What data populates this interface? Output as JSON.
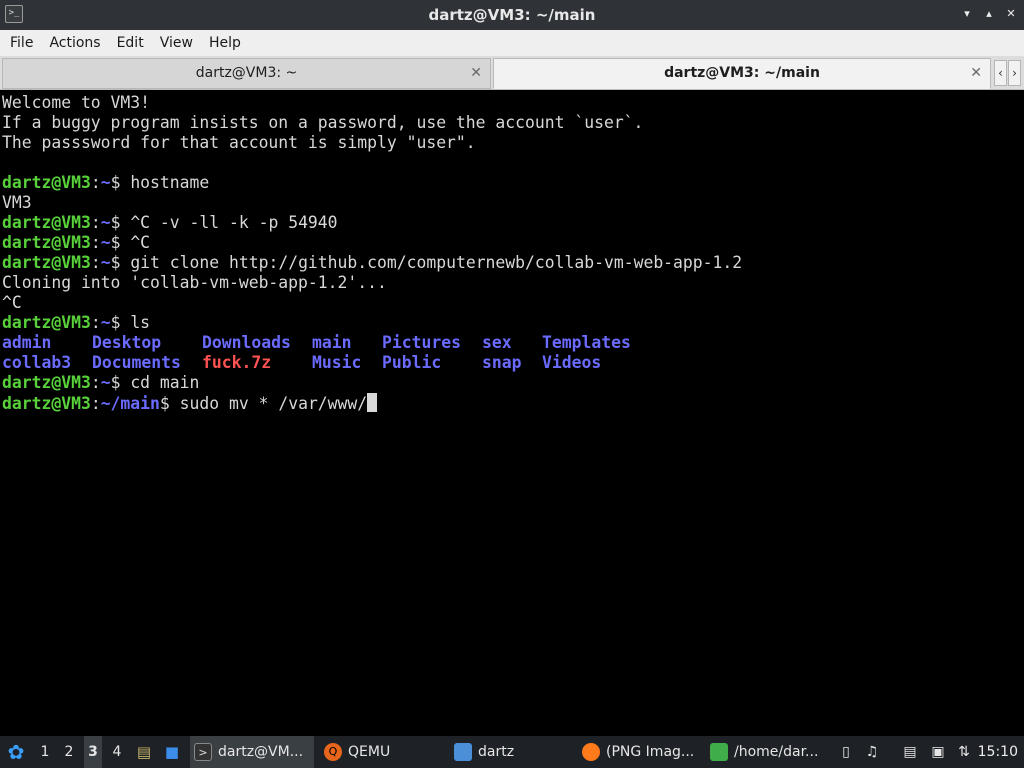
{
  "window": {
    "title": "dartz@VM3: ~/main",
    "app_icon": "terminal-icon",
    "buttons": [
      "minimize",
      "maximize",
      "close"
    ]
  },
  "menu": [
    "File",
    "Actions",
    "Edit",
    "View",
    "Help"
  ],
  "tabs": [
    {
      "label": "dartz@VM3: ~",
      "active": false
    },
    {
      "label": "dartz@VM3: ~/main",
      "active": true
    }
  ],
  "terminal": {
    "welcome": [
      "Welcome to VM3!",
      "If a buggy program insists on a password, use the account `user`.",
      "The passsword for that account is simply \"user\"."
    ],
    "prompt_user": "dartz@VM3",
    "prompt_home": "~",
    "prompt_main": "~/main",
    "commands": {
      "c1": "hostname",
      "o1": "VM3",
      "c2": "^C -v -ll -k -p 54940",
      "c3": "^C",
      "c4": "git clone http://github.com/computernewb/collab-vm-web-app-1.2",
      "o4a": "Cloning into 'collab-vm-web-app-1.2'...",
      "o4b": "^C",
      "c5": "ls",
      "c6": "cd main",
      "c7": "sudo mv * /var/www/"
    },
    "ls_rows": [
      [
        {
          "name": "admin",
          "kind": "dir"
        },
        {
          "name": "Desktop",
          "kind": "dir"
        },
        {
          "name": "Downloads",
          "kind": "dir"
        },
        {
          "name": "main",
          "kind": "dir"
        },
        {
          "name": "Pictures",
          "kind": "dir"
        },
        {
          "name": "sex",
          "kind": "dir"
        },
        {
          "name": "Templates",
          "kind": "dir"
        }
      ],
      [
        {
          "name": "collab3",
          "kind": "dir"
        },
        {
          "name": "Documents",
          "kind": "dir"
        },
        {
          "name": "fuck.7z",
          "kind": "archive"
        },
        {
          "name": "Music",
          "kind": "dir"
        },
        {
          "name": "Public",
          "kind": "dir"
        },
        {
          "name": "snap",
          "kind": "dir"
        },
        {
          "name": "Videos",
          "kind": "dir"
        }
      ]
    ],
    "colors": {
      "prompt": "#58d13a",
      "dir": "#6b6bff",
      "archive": "#ff5252",
      "text": "#d8d8d8",
      "background": "#000000"
    }
  },
  "taskbar": {
    "desktops": [
      "1",
      "2",
      "3",
      "4"
    ],
    "active_desktop": "3",
    "tasks": [
      {
        "label": "dartz@VM...",
        "icon": "terminal-icon",
        "active": true
      },
      {
        "label": "QEMU",
        "icon": "qemu-icon",
        "active": false
      },
      {
        "label": "dartz",
        "icon": "folder-icon",
        "active": false
      },
      {
        "label": "(PNG Imag...",
        "icon": "firefox-icon",
        "active": false
      },
      {
        "label": "/home/dar...",
        "icon": "text-editor-icon",
        "active": false
      }
    ],
    "clock": "15:10"
  }
}
